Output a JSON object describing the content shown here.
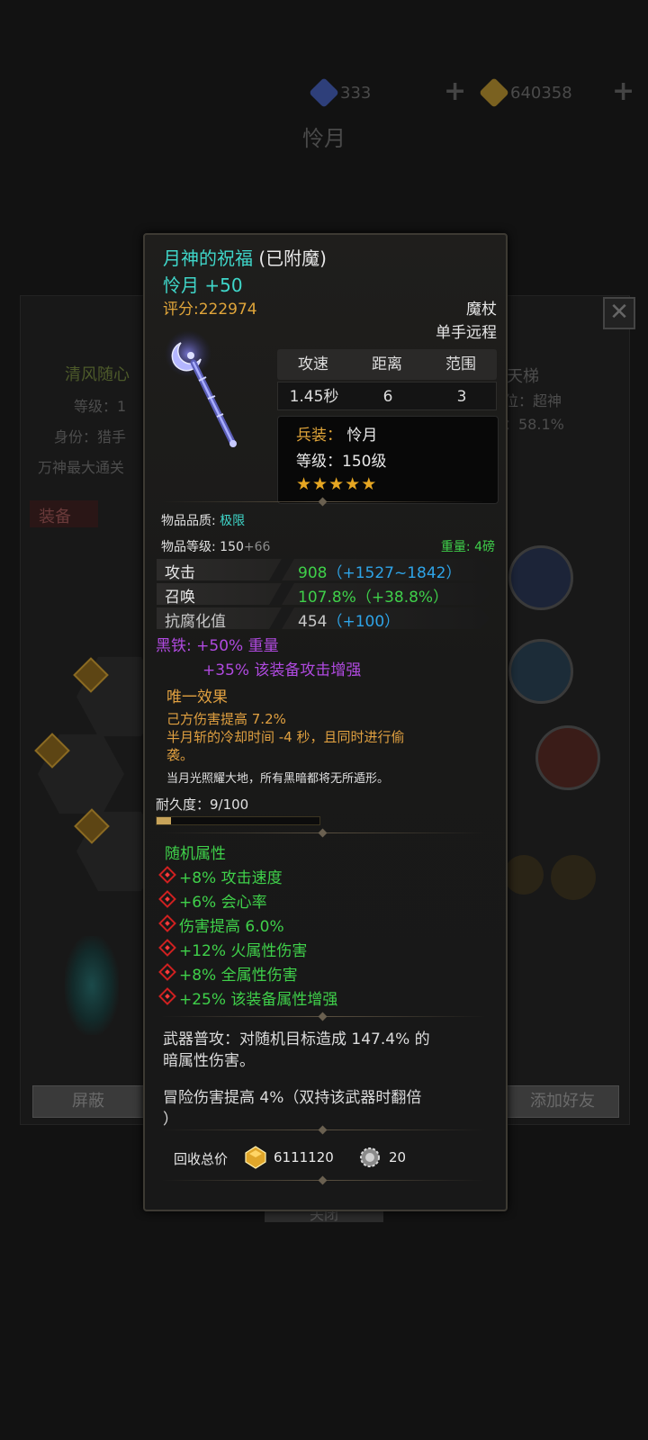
{
  "top_bar": {
    "gems": "333",
    "gold": "640358",
    "gem_color": "#2e3f7a",
    "gold_color": "#8a6d1e"
  },
  "bg": {
    "title": "怜月",
    "left_name": "清风随心",
    "left_level": "等级：1",
    "left_role": "身份：猎手",
    "left_note": "万神最大通关",
    "right_name": "天梯",
    "right_rank": "位：超神",
    "right_rate": "：58.1%",
    "equip_tab": "装备",
    "btn_block": "屏蔽",
    "btn_add_friend": "添加好友",
    "btn_bottom": "关闭"
  },
  "item": {
    "name": "月神的祝福",
    "enchant": "(已附魔)",
    "subtitle": "怜月 +50",
    "score": "评分:222974",
    "type": "魔杖",
    "hand": "单手远程",
    "stats_head": [
      "攻速",
      "距离",
      "范围"
    ],
    "stats_vals": [
      "1.45秒",
      "6",
      "3"
    ],
    "weapon_label": "兵装：",
    "weapon_value": "怜月",
    "level_label": "等级：",
    "level_value": "150级",
    "stars": 5,
    "quality_label": "物品品质:",
    "quality_value": "极限",
    "item_level_label": "物品等级:",
    "item_level_base": "150",
    "item_level_bonus": "+66",
    "weight_label": "重量:",
    "weight_value": "4磅",
    "attrs": [
      {
        "name": "攻击",
        "value": "908",
        "bonus": "（+1527~1842）"
      },
      {
        "name": "召唤",
        "value": "107.8%",
        "bonus": "（+38.8%）"
      },
      {
        "name": "抗腐化值",
        "value": "454",
        "bonus": "（+100）"
      }
    ],
    "black_iron_label": "黑铁:",
    "black_iron_1": "+50% 重量",
    "black_iron_2": "+35% 该装备攻击增强",
    "unique_title": "唯一效果",
    "unique_1": "己方伤害提高 7.2%",
    "unique_2a": "半月斩的冷却时间 -4 秒，且同时进行偷",
    "unique_2b": "袭。",
    "flavor": "当月光照耀大地，所有黑暗都将无所遁形。",
    "durability_label": "耐久度：9/100",
    "durability": 0.09,
    "random_title": "随机属性",
    "random_attrs": [
      "+8% 攻击速度",
      "+6% 会心率",
      "伤害提高 6.0%",
      "+12% 火属性伤害",
      "+8% 全属性伤害",
      "+25% 该装备属性增强"
    ],
    "weapon_attack_1": "武器普攻：对随机目标造成 147.4% 的",
    "weapon_attack_2": "暗属性伤害。",
    "adventure_1": "冒险伤害提高 4%（双持该武器时翻倍",
    "adventure_2": "）",
    "recycle_label": "回收总价",
    "recycle_gold": "6111120",
    "recycle_gear": "20"
  },
  "colors": {
    "cyan": "#3fd6c9",
    "gold": "#e0a53a",
    "green": "#3fd04a",
    "blue": "#2ea4e8",
    "purple": "#b04ae0",
    "orange": "#e0a040"
  }
}
